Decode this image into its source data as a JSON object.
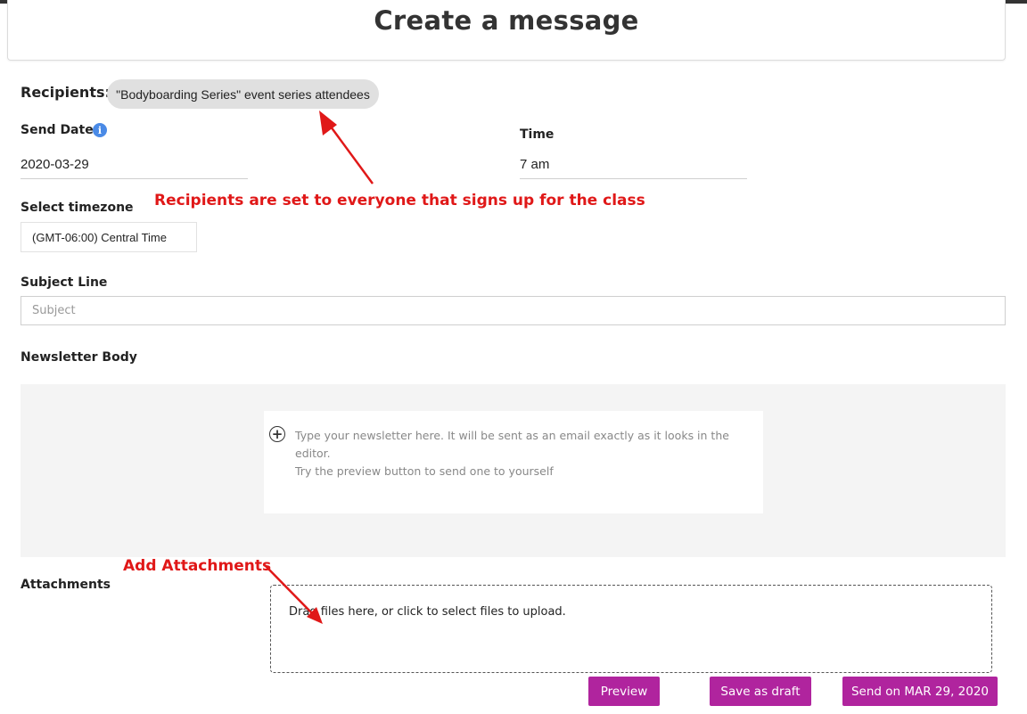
{
  "page": {
    "title": "Create a message"
  },
  "recipients": {
    "label": "Recipients:",
    "chip": "\"Bodyboarding Series\" event series attendees"
  },
  "send_date": {
    "label": "Send Date",
    "value": "2020-03-29",
    "icon": "info-icon"
  },
  "time": {
    "label": "Time",
    "value": "7 am"
  },
  "timezone": {
    "label": "Select timezone",
    "value": "(GMT-06:00) Central Time"
  },
  "subject": {
    "label": "Subject Line",
    "placeholder": "Subject"
  },
  "body": {
    "label": "Newsletter Body",
    "placeholder_line1": "Type your newsletter here. It will be sent as an email exactly as it looks in the editor.",
    "placeholder_line2": "Try the preview button to send one to yourself",
    "icon": "plus-circle-icon"
  },
  "attachments": {
    "label": "Attachments",
    "dropzone_text": "Drag files here, or click to select files to upload."
  },
  "buttons": {
    "preview": "Preview",
    "save_draft": "Save as draft",
    "send": "Send on MAR 29, 2020"
  },
  "annotations": {
    "recipients_note": "Recipients are set to everyone that signs up for the class",
    "attachments_note": "Add Attachments"
  },
  "colors": {
    "button": "#b0249e",
    "annotation": "#e01818",
    "info_icon": "#4a8ae6"
  }
}
